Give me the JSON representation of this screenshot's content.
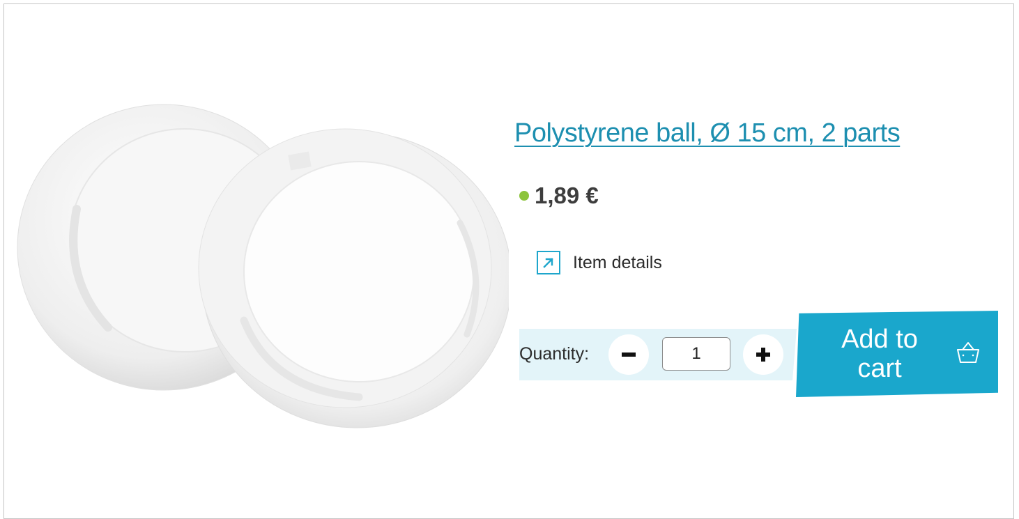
{
  "product": {
    "title": "Polystyrene ball, Ø 15 cm, 2 parts",
    "price": "1,89 €",
    "details_label": "Item details",
    "image_icon": "product-image"
  },
  "quantity": {
    "label": "Quantity:",
    "value": "1",
    "minus_icon": "minus-icon",
    "plus_icon": "plus-icon"
  },
  "cart": {
    "button_label": "Add to cart",
    "icon": "basket-icon"
  },
  "colors": {
    "accent": "#1aa7cc",
    "link": "#1d8fb0",
    "stock": "#8cc43c",
    "quantity_bg": "#e3f4f9"
  }
}
